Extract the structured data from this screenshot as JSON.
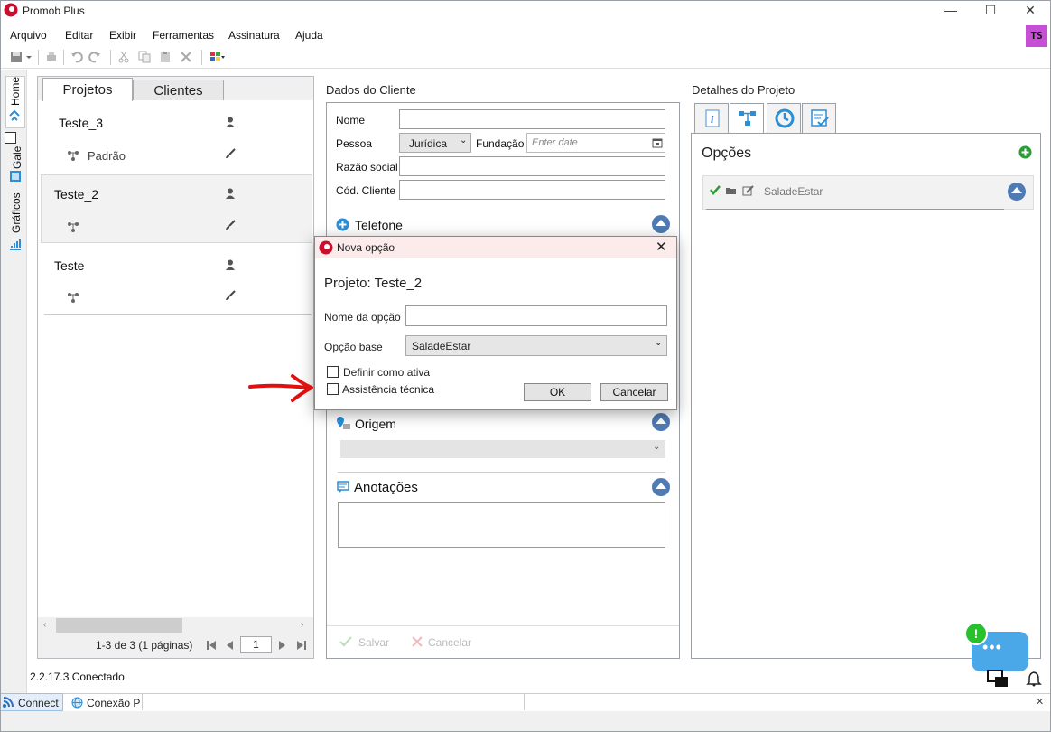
{
  "window": {
    "title": "Promob Plus",
    "minimize": "—",
    "maximize": "☐",
    "close": "✕"
  },
  "menu": [
    "Arquivo",
    "Editar",
    "Exibir",
    "Ferramentas",
    "Assinatura",
    "Ajuda"
  ],
  "user_badge": "TS",
  "side_tabs": {
    "home": "Home",
    "gallery": "Gale",
    "charts": "Gráficos"
  },
  "projects": {
    "tabs": [
      "Projetos",
      "Clientes"
    ],
    "items": [
      {
        "name": "Teste_3",
        "sub": "Padrão"
      },
      {
        "name": "Teste_2",
        "sub": ""
      },
      {
        "name": "Teste",
        "sub": ""
      }
    ],
    "pagination": "1-3 de 3 (1 páginas)",
    "page": "1"
  },
  "dados": {
    "header": "Dados do Cliente",
    "nome_label": "Nome",
    "pessoa_label": "Pessoa",
    "pessoa_value": "Jurídica",
    "fundacao_label": "Fundação",
    "fundacao_placeholder": "Enter date",
    "razao_label": "Razão social",
    "cod_label": "Cód. Cliente",
    "telefone": "Telefone",
    "origem": "Origem",
    "anotacoes": "Anotações",
    "salvar": "Salvar",
    "cancelar": "Cancelar"
  },
  "detalhes": {
    "header": "Detalhes do Projeto",
    "opcoes": "Opções",
    "option_item": "SaladeEstar"
  },
  "dialog": {
    "title": "Nova opção",
    "projeto": "Projeto: Teste_2",
    "nome_label": "Nome da opção",
    "base_label": "Opção base",
    "base_value": "SaladeEstar",
    "definir": "Definir como ativa",
    "assistencia": "Assistência técnica",
    "ok": "OK",
    "cancelar": "Cancelar",
    "close": "✕"
  },
  "status": {
    "version": "2.2.17.3 Conectado"
  },
  "bottom": {
    "connect": "Connect",
    "conexao": "Conexão P",
    "close": "✕"
  },
  "chat": {
    "alert": "!",
    "dots": "•••"
  }
}
